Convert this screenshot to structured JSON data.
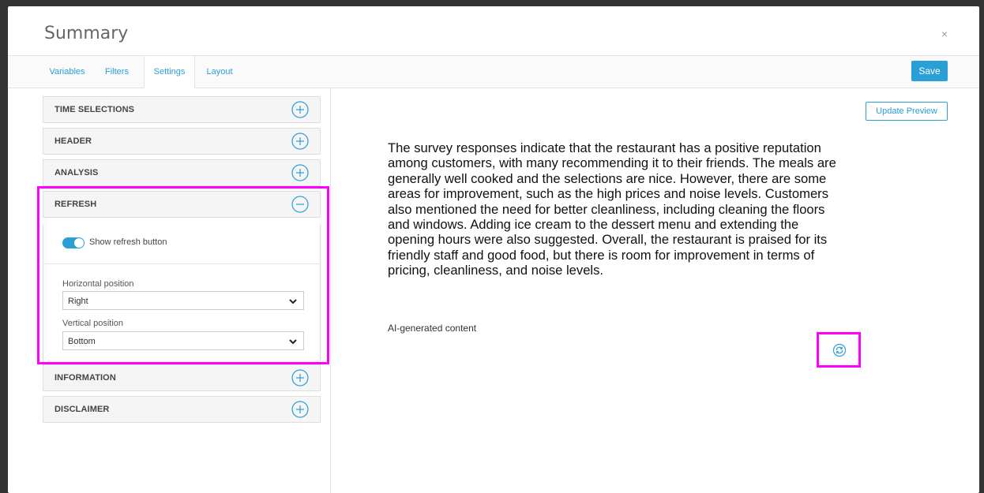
{
  "dialog": {
    "title": "Summary",
    "close_label": "×",
    "save_label": "Save"
  },
  "tabs": [
    {
      "label": "Variables",
      "active": false
    },
    {
      "label": "Filters",
      "active": false
    },
    {
      "label": "Settings",
      "active": true
    },
    {
      "label": "Layout",
      "active": false
    }
  ],
  "sections": [
    {
      "label": "TIME SELECTIONS",
      "expanded": false,
      "icon": "plus-circle-icon"
    },
    {
      "label": "HEADER",
      "expanded": false,
      "icon": "plus-circle-icon"
    },
    {
      "label": "ANALYSIS",
      "expanded": false,
      "icon": "plus-circle-icon"
    },
    {
      "label": "REFRESH",
      "expanded": true,
      "icon": "minus-circle-icon"
    },
    {
      "label": "INFORMATION",
      "expanded": false,
      "icon": "plus-circle-icon"
    },
    {
      "label": "DISCLAIMER",
      "expanded": false,
      "icon": "plus-circle-icon"
    }
  ],
  "refresh": {
    "toggle_label": "Show refresh button",
    "toggle_on": true,
    "horizontal_label": "Horizontal position",
    "horizontal_value": "Right",
    "vertical_label": "Vertical position",
    "vertical_value": "Bottom"
  },
  "preview": {
    "update_label": "Update Preview",
    "summary": "The survey responses indicate that the restaurant has a positive reputation among customers, with many recommending it to their friends. The meals are generally well cooked and the selections are nice. However, there are some areas for improvement, such as the high prices and noise levels. Customers also mentioned the need for better cleanliness, including cleaning the floors and windows. Adding ice cream to the dessert menu and extending the opening hours were also suggested. Overall, the restaurant is praised for its friendly staff and good food, but there is room for improvement in terms of pricing, cleanliness, and noise levels.",
    "ai_label": "AI-generated content",
    "refresh_icon": "refresh-icon"
  },
  "colors": {
    "accent": "#2a9fd6",
    "highlight": "#ff00ff"
  }
}
